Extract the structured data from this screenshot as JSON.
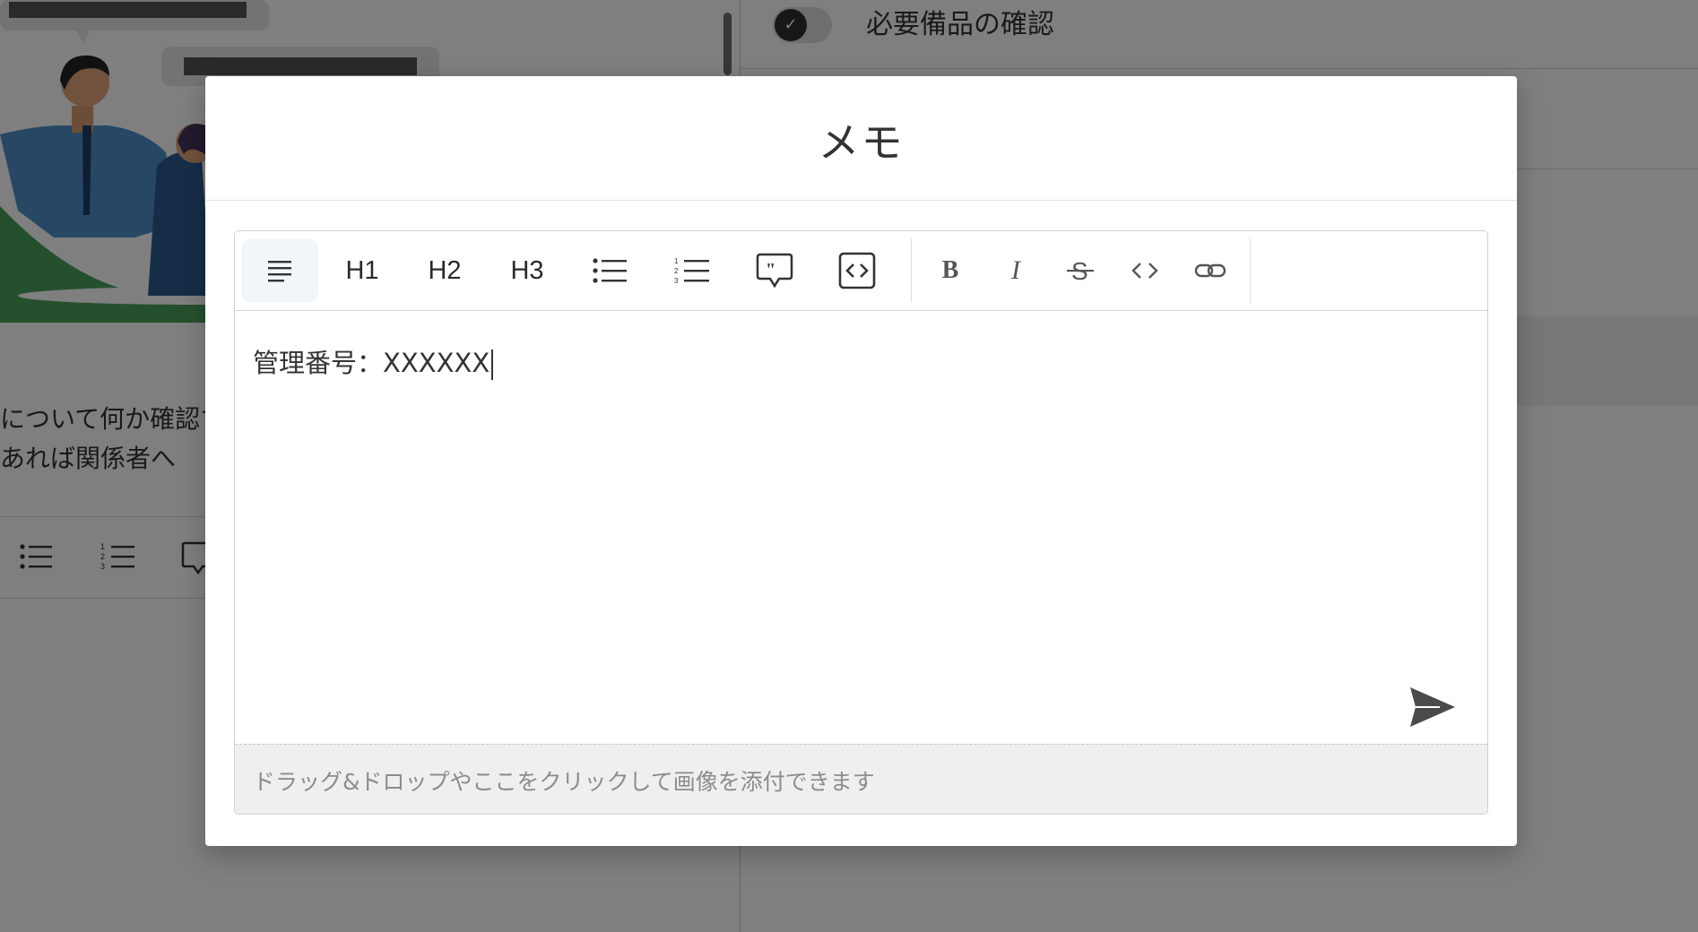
{
  "background": {
    "checklist_item_label": "必要備品の確認",
    "text_line_1": "について何か確認す",
    "text_line_2": "あれば関係者へ"
  },
  "modal": {
    "title": "メモ",
    "toolbar": {
      "paragraph": "paragraph-icon",
      "h1": "H1",
      "h2": "H2",
      "h3": "H3",
      "bullet_list": "bullet-list-icon",
      "ordered_list": "ordered-list-icon",
      "blockquote": "blockquote-icon",
      "code_block": "code-block-icon",
      "bold": "B",
      "italic": "I",
      "strike": "strikethrough-icon",
      "inline_code": "inline-code-icon",
      "link": "link-icon"
    },
    "content_text": "管理番号：XXXXXX",
    "dropzone_text": "ドラッグ&ドロップやここをクリックして画像を添付できます"
  }
}
